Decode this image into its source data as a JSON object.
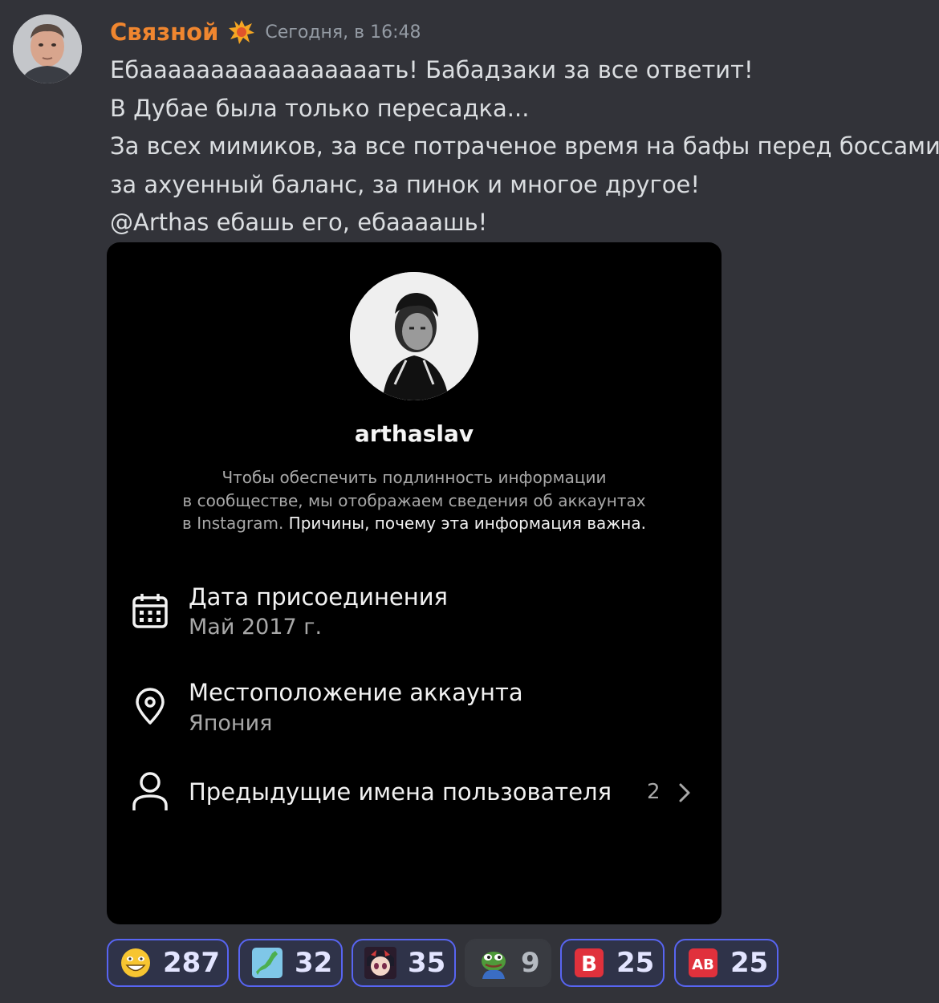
{
  "message": {
    "author": "Связной",
    "author_color": "#f0862f",
    "role_icon": "explosion-icon",
    "timestamp": "Сегодня, в 16:48",
    "lines": [
      "Ебааааааааааааааааать! Бабадзаки за все ответит!",
      "В Дубае была только пересадка...",
      "За всех мимиков, за все потраченое время на бафы перед боссами,",
      "за ахуенный баланс, за пинок и многое другое!"
    ],
    "last_line": {
      "mention": "@Arthas",
      "rest": " ебашь его, ебаааашь!"
    }
  },
  "attachment": {
    "username": "arthaslav",
    "notice_lines": [
      "Чтобы обеспечить подлинность информации",
      "в сообществе, мы отображаем сведения об аккаунтах"
    ],
    "notice_last_prefix": "в Instagram. ",
    "notice_link": "Причины, почему эта информация важна.",
    "rows": [
      {
        "icon": "calendar-icon",
        "title": "Дата присоединения",
        "value": "Май 2017 г."
      },
      {
        "icon": "location-pin-icon",
        "title": "Местоположение аккаунта",
        "value": "Япония"
      },
      {
        "icon": "user-icon",
        "title": "Предыдущие имена пользователя",
        "count": "2"
      }
    ]
  },
  "reactions": [
    {
      "emoji": "grinning-face-emoji",
      "count": "287",
      "reacted": true
    },
    {
      "emoji": "japan-map-emoji",
      "count": "32",
      "reacted": true
    },
    {
      "emoji": "anime-girl-emoji",
      "count": "35",
      "reacted": true
    },
    {
      "emoji": "pepe-frog-emoji",
      "count": "9",
      "reacted": false
    },
    {
      "emoji": "b-button-emoji",
      "count": "25",
      "reacted": true
    },
    {
      "emoji": "ab-button-emoji",
      "count": "25",
      "reacted": true
    }
  ]
}
